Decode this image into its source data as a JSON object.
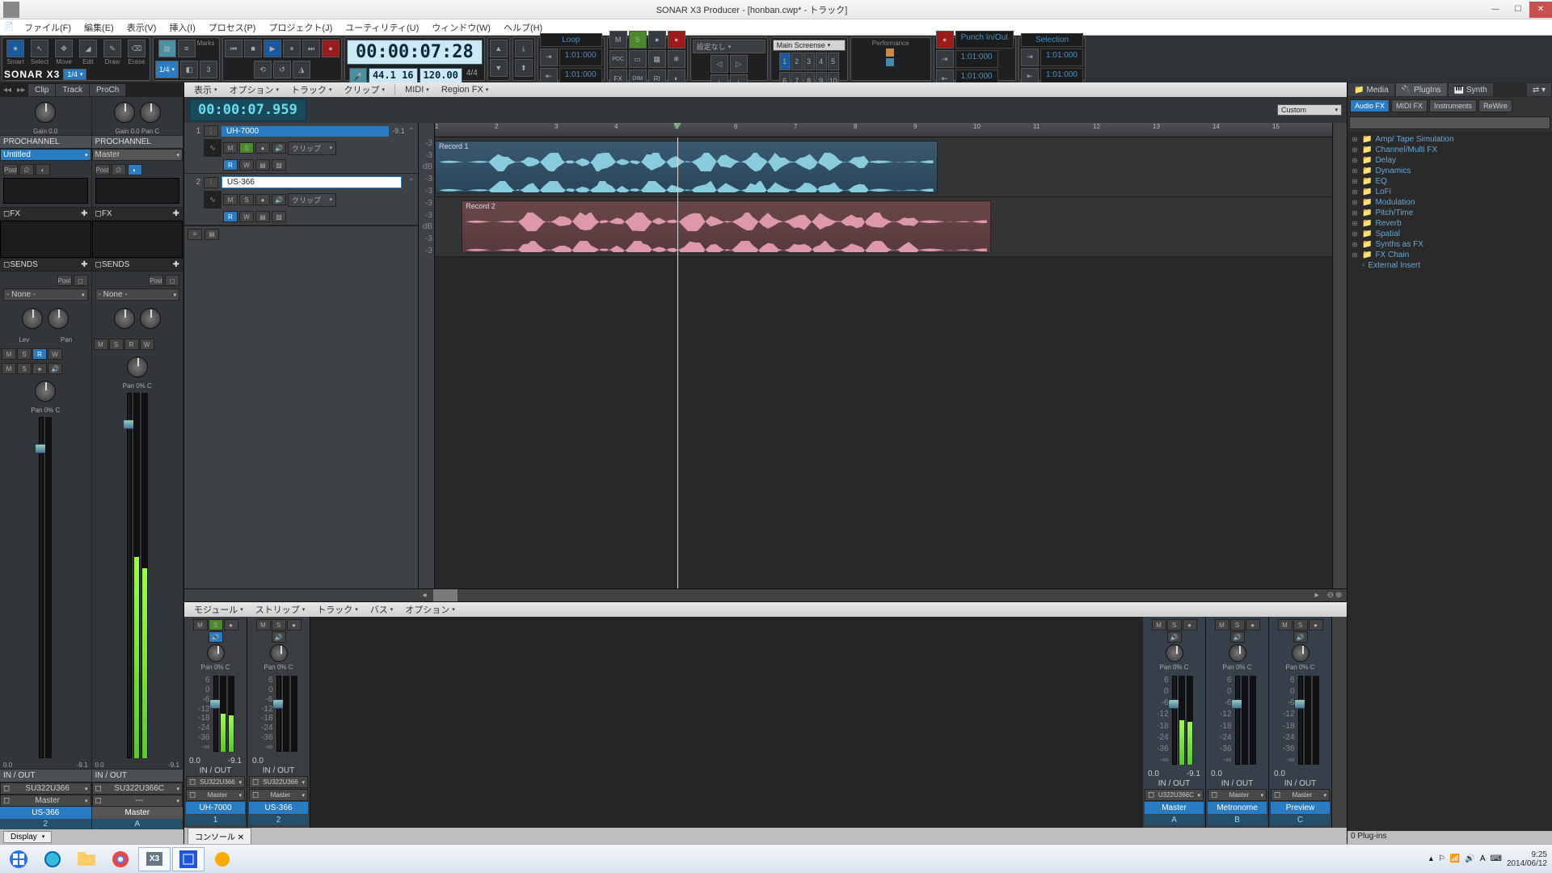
{
  "window": {
    "title": "SONAR X3 Producer - [honban.cwp* - トラック]"
  },
  "menu": [
    "ファイル(F)",
    "編集(E)",
    "表示(V)",
    "挿入(I)",
    "プロセス(P)",
    "プロジェクト(J)",
    "ユーティリティ(U)",
    "ウィンドウ(W)",
    "ヘルプ(H)"
  ],
  "logo": "SONAR X3",
  "toolbox": {
    "snap_a": "1/4",
    "snap_b": "1/4",
    "labels": [
      "Smart",
      "Select",
      "Move",
      "Edit",
      "Draw",
      "Erase"
    ]
  },
  "transport": {
    "time": "00:00:07:28",
    "bars": "44.1 16",
    "tempo": "120.00",
    "sig": "4/4"
  },
  "loop": {
    "label": "Loop",
    "start": "1:01:000",
    "end": "1:01:000"
  },
  "mixstrip": {
    "M": "M",
    "S": "S",
    "PDC": "PDC",
    "FX": "FX",
    "DIM": "DIM",
    "RI": "RI"
  },
  "screenset": {
    "setting": "設定なし",
    "preset": "Main Screense"
  },
  "performance": {
    "label": "Performance"
  },
  "punch": {
    "label": "Punch In/Out",
    "start": "1:01:000",
    "end": "1:01:000"
  },
  "selection": {
    "label": "Selection",
    "start": "1:01:000",
    "end": "1:01:000"
  },
  "markers": {
    "label": "Marks"
  },
  "submenu": {
    "view": "表示",
    "option": "オプション",
    "track": "トラック",
    "clip": "クリップ",
    "midi": "MIDI",
    "region": "Region FX"
  },
  "inspector": {
    "tabs": [
      "Clip",
      "Track",
      "ProCh"
    ],
    "left": {
      "pro": "PROCHANNEL",
      "name": "Untitled",
      "pan": "Pan  0% C",
      "fx": "FX",
      "sends": "SENDS",
      "post": "Post",
      "none": "- None -",
      "io": "IN / OUT",
      "in": "SU322U366",
      "out": "Master",
      "trk": "US-366",
      "tn": "2",
      "gain": "Gain  0.0",
      "db": "0.0",
      "db2": "-9.1",
      "lev": "Lev",
      "panlbl": "Pan",
      "postlbl": "Post"
    },
    "right": {
      "pro": "PROCHANNEL",
      "name": "Master",
      "pan": "Pan  0% C",
      "fx": "FX",
      "sends": "SENDS",
      "post": "Post",
      "none": "- None -",
      "io": "IN / OUT",
      "in": "SU322U366C",
      "out": "---",
      "trk": "Master",
      "tn": "A",
      "gain": "Gain 0.0 Pan   C",
      "db": "0.0",
      "db2": "-9.1",
      "postlbl": "Post"
    }
  },
  "trackview": {
    "now": "00:00:07.959",
    "preset": "Custom",
    "ruler": [
      1,
      2,
      3,
      4,
      5,
      6,
      7,
      8,
      9,
      10,
      11,
      12,
      13,
      14,
      15
    ],
    "tracks": [
      {
        "num": "1",
        "name": "UH-7000",
        "db": "-9.1",
        "clip": "クリップ",
        "rec": "Record 1",
        "color": "blue",
        "clipStart": 0,
        "clipEnd": 56
      },
      {
        "num": "2",
        "name": "US-366",
        "db": "",
        "clip": "クリップ",
        "rec": "Record 2",
        "color": "red",
        "clipStart": 3,
        "clipEnd": 62,
        "editing": true
      }
    ],
    "dbscale": [
      "-3",
      "-3",
      "dB",
      "-3",
      "-3"
    ]
  },
  "console": {
    "menu": [
      "モジュール",
      "ストリップ",
      "トラック",
      "バス",
      "オプション"
    ],
    "tracks": [
      {
        "name": "UH-7000",
        "num": "1",
        "pan": "Pan 0% C",
        "io": "IN / OUT",
        "in": "SU322U366",
        "out": "Master",
        "db": "0.0",
        "db2": "-9.1",
        "solo": true
      },
      {
        "name": "US-366",
        "num": "2",
        "pan": "Pan 0% C",
        "io": "IN / OUT",
        "in": "SU322U366",
        "out": "Master",
        "db": "0.0"
      }
    ],
    "buses": [
      {
        "name": "Master",
        "num": "A",
        "pan": "Pan 0% C",
        "io": "IN / OUT",
        "in": "U322U366C",
        "db": "0.0",
        "db2": "-9.1"
      },
      {
        "name": "Metronome",
        "num": "B",
        "pan": "Pan 0% C",
        "io": "IN / OUT",
        "in": "Master",
        "db": "0.0"
      },
      {
        "name": "Preview",
        "num": "C",
        "pan": "Pan 0% C",
        "io": "IN / OUT",
        "in": "Master",
        "db": "0.0"
      }
    ],
    "scale": [
      "6",
      "0",
      "-6",
      "-12",
      "-18",
      "-24",
      "-36",
      "-∞"
    ],
    "tab": "コンソール"
  },
  "browser": {
    "tabs": [
      "Media",
      "PlugIns",
      "Synth"
    ],
    "filters": [
      "Audio FX",
      "MIDI FX",
      "Instruments",
      "ReWire"
    ],
    "tree": [
      "Amp/ Tape Simulation",
      "Channel/Multi FX",
      "Delay",
      "Dynamics",
      "EQ",
      "LoFi",
      "Modulation",
      "Pitch/Time",
      "Reverb",
      "Spatial",
      "Synths as FX",
      "FX Chain",
      "External Insert"
    ],
    "status": "0 Plug-ins"
  },
  "display_dropdown": "Display",
  "taskbar": {
    "time": "9:25",
    "date": "2014/06/12"
  }
}
